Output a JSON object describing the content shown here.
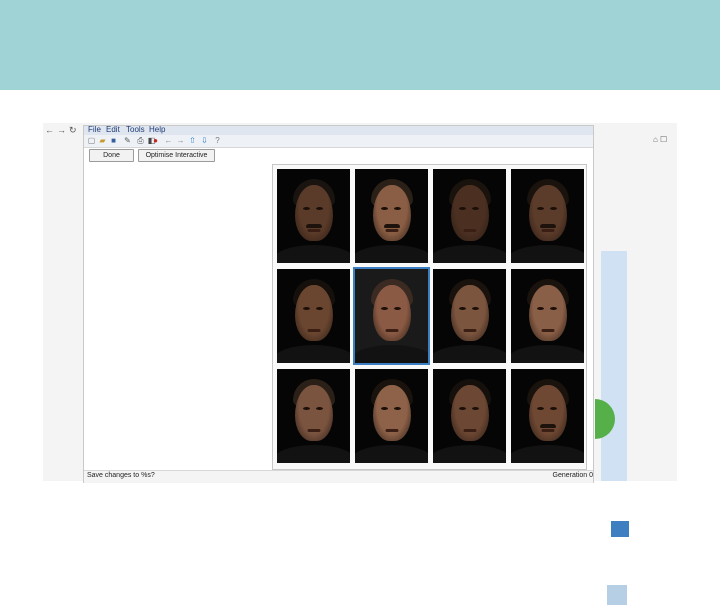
{
  "app": {
    "menu": [
      "File",
      "Edit",
      "Tools",
      "Help"
    ],
    "buttons": {
      "done": "Done",
      "optimise": "Optimise Interactive"
    },
    "status": {
      "left": "Save changes to %s?",
      "right": "Generation 0"
    }
  },
  "face_grid": {
    "rows": 3,
    "columns": 4,
    "selected_index": 5,
    "faces": [
      {
        "skin": "#5a3a28",
        "hair": "#1a1410",
        "stache": true
      },
      {
        "skin": "#8a5e44",
        "hair": "#2a2018",
        "stache": true
      },
      {
        "skin": "#4b3022",
        "hair": "#1a120c",
        "stache": false
      },
      {
        "skin": "#5b3b2a",
        "hair": "#1a120c",
        "stache": true
      },
      {
        "skin": "#6a4630",
        "hair": "#15100c",
        "stache": false
      },
      {
        "skin": "#8a5a44",
        "hair": "#3a2a22",
        "stache": false
      },
      {
        "skin": "#7c553f",
        "hair": "#1a120c",
        "stache": false
      },
      {
        "skin": "#8a5f47",
        "hair": "#1a120c",
        "stache": false
      },
      {
        "skin": "#7b5440",
        "hair": "#2a2018",
        "stache": false
      },
      {
        "skin": "#8e6249",
        "hair": "#1a120c",
        "stache": false
      },
      {
        "skin": "#6c4733",
        "hair": "#15100c",
        "stache": false
      },
      {
        "skin": "#6e4833",
        "hair": "#1a120c",
        "stache": true
      }
    ]
  },
  "colors": {
    "header_band": "#9fd3d6",
    "selection": "#3c7ec2"
  }
}
